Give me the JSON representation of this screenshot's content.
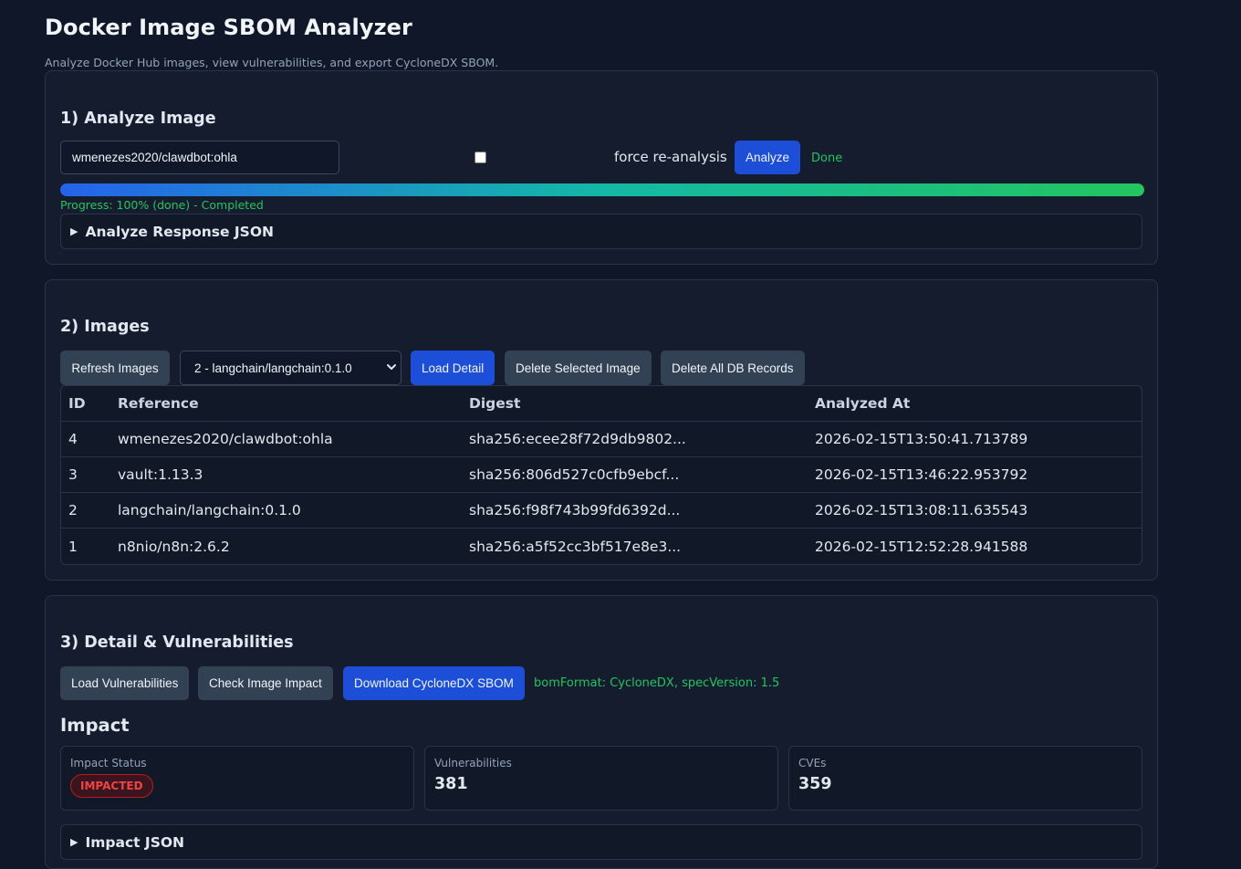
{
  "app": {
    "title": "Docker Image SBOM Analyzer",
    "subtitle": "Analyze Docker Hub images, view vulnerabilities, and export CycloneDX SBOM."
  },
  "analyze": {
    "heading": "1) Analyze Image",
    "image_ref_value": "wmenezes2020/clawdbot:ohla",
    "force_label": "force re-analysis",
    "force_checked": false,
    "analyze_button": "Analyze",
    "status": "Done",
    "progress_percent": 100,
    "progress_text": "Progress: 100% (done) - Completed",
    "response_json_summary": "Analyze Response JSON"
  },
  "images": {
    "heading": "2) Images",
    "refresh_button": "Refresh Images",
    "selected_image": "2 - langchain/langchain:0.1.0",
    "load_detail_button": "Load Detail",
    "delete_selected_button": "Delete Selected Image",
    "delete_all_button": "Delete All DB Records",
    "columns": [
      "ID",
      "Reference",
      "Digest",
      "Analyzed At"
    ],
    "rows": [
      {
        "id": "4",
        "reference": "wmenezes2020/clawdbot:ohla",
        "digest": "sha256:ecee28f72d9db9802...",
        "analyzed_at": "2026-02-15T13:50:41.713789"
      },
      {
        "id": "3",
        "reference": "vault:1.13.3",
        "digest": "sha256:806d527c0cfb9ebcf...",
        "analyzed_at": "2026-02-15T13:46:22.953792"
      },
      {
        "id": "2",
        "reference": "langchain/langchain:0.1.0",
        "digest": "sha256:f98f743b99fd6392d...",
        "analyzed_at": "2026-02-15T13:08:11.635543"
      },
      {
        "id": "1",
        "reference": "n8nio/n8n:2.6.2",
        "digest": "sha256:a5f52cc3bf517e8e3...",
        "analyzed_at": "2026-02-15T12:52:28.941588"
      }
    ]
  },
  "detail": {
    "heading": "3) Detail & Vulnerabilities",
    "load_vulns_button": "Load Vulnerabilities",
    "check_impact_button": "Check Image Impact",
    "download_sbom_button": "Download CycloneDX SBOM",
    "bom_info": "bomFormat: CycloneDX, specVersion: 1.5",
    "impact_heading": "Impact",
    "impact_status_label": "Impact Status",
    "impact_status_value": "IMPACTED",
    "vulnerabilities_label": "Vulnerabilities",
    "vulnerabilities_value": "381",
    "cves_label": "CVEs",
    "cves_value": "359",
    "impact_json_summary": "Impact JSON"
  },
  "colors": {
    "background": "#0f1729",
    "card": "#141c2e",
    "primary_button": "#1d4ed8",
    "secondary_button": "#334155",
    "success_text": "#22c55e",
    "danger_badge": "#ef4444"
  },
  "icons": {
    "disclosure": "triangle-right-icon",
    "select_arrow": "chevron-down-icon"
  }
}
